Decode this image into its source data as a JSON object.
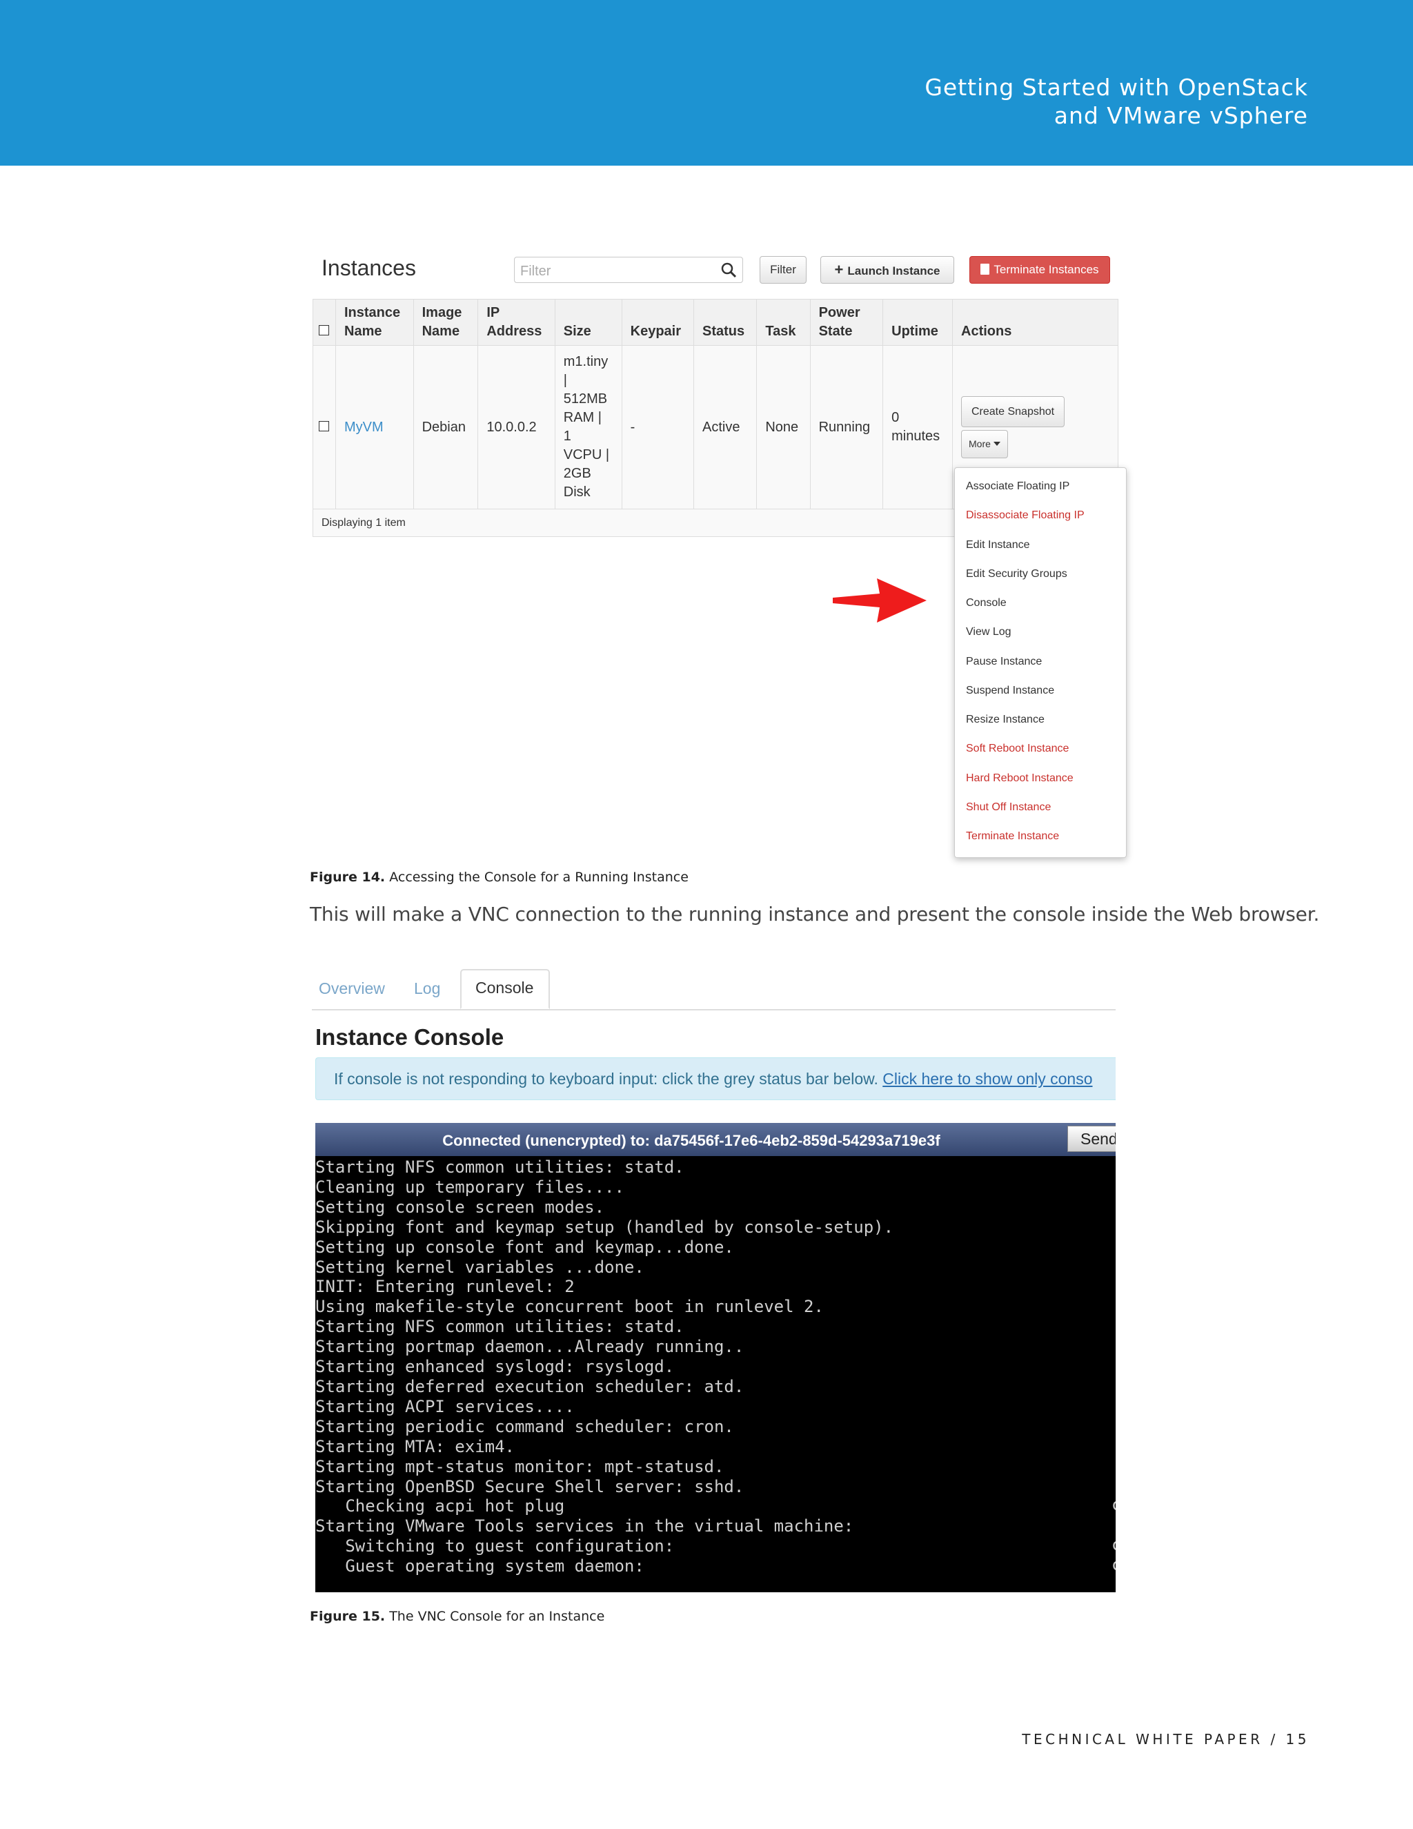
{
  "header": {
    "title_line1": "Getting Started with OpenStack",
    "title_line2": "and VMware vSphere",
    "color": "#1d93d2"
  },
  "instances": {
    "title": "Instances",
    "filter_placeholder": "Filter",
    "filter_button": "Filter",
    "launch_button": "Launch Instance",
    "terminate_button": "Terminate Instances",
    "columns": [
      "Instance Name",
      "Image Name",
      "IP Address",
      "Size",
      "Keypair",
      "Status",
      "Task",
      "Power State",
      "Uptime",
      "Actions"
    ],
    "column_lines": [
      [
        "Instance",
        "Name"
      ],
      [
        "Image",
        "Name"
      ],
      [
        "IP",
        "Address"
      ],
      [
        "Size"
      ],
      [
        "Keypair"
      ],
      [
        "Status"
      ],
      [
        "Task"
      ],
      [
        "Power",
        "State"
      ],
      [
        "Uptime"
      ],
      [
        "Actions"
      ]
    ],
    "row": {
      "instance_name": "MyVM",
      "image_name": "Debian",
      "ip_address": "10.0.0.2",
      "size_lines": [
        "m1.tiny",
        "|",
        "512MB",
        "RAM |",
        "1",
        "VCPU |",
        "2GB",
        "Disk"
      ],
      "keypair": "-",
      "status": "Active",
      "task": "None",
      "power_state": "Running",
      "uptime_lines": [
        "0",
        "minutes"
      ],
      "action_primary": "Create Snapshot",
      "action_more": "More"
    },
    "footer": "Displaying 1 item",
    "more_menu": [
      {
        "label": "Associate Floating IP",
        "danger": false
      },
      {
        "label": "Disassociate Floating IP",
        "danger": true
      },
      {
        "label": "Edit Instance",
        "danger": false
      },
      {
        "label": "Edit Security Groups",
        "danger": false
      },
      {
        "label": "Console",
        "danger": false
      },
      {
        "label": "View Log",
        "danger": false
      },
      {
        "label": "Pause Instance",
        "danger": false
      },
      {
        "label": "Suspend Instance",
        "danger": false
      },
      {
        "label": "Resize Instance",
        "danger": false
      },
      {
        "label": "Soft Reboot Instance",
        "danger": true
      },
      {
        "label": "Hard Reboot Instance",
        "danger": true
      },
      {
        "label": "Shut Off Instance",
        "danger": true
      },
      {
        "label": "Terminate Instance",
        "danger": true
      }
    ]
  },
  "figure14_caption": {
    "label": "Figure 14.",
    "text": "Accessing the Console for a Running Instance"
  },
  "body_text": "This will make a VNC connection to the running instance and present the console inside the Web browser.",
  "console": {
    "tabs": [
      "Overview",
      "Log",
      "Console"
    ],
    "active_tab": "Console",
    "title": "Instance Console",
    "info_text": "If console is not responding to keyboard input: click the grey status bar below.",
    "info_link": "Click here to show only conso",
    "vnc_status": "Connected (unencrypted) to: da75456f-17e6-4eb2-859d-54293a719e3f",
    "vnc_send_button": "Send",
    "terminal_lines": [
      "Starting NFS common utilities: statd.",
      "Cleaning up temporary files....",
      "Setting console screen modes.",
      "Skipping font and keymap setup (handled by console-setup).",
      "Setting up console font and keymap...done.",
      "Setting kernel variables ...done.",
      "INIT: Entering runlevel: 2",
      "Using makefile-style concurrent boot in runlevel 2.",
      "Starting NFS common utilities: statd.",
      "Starting portmap daemon...Already running..",
      "Starting enhanced syslogd: rsyslogd.",
      "Starting deferred execution scheduler: atd.",
      "Starting ACPI services....",
      "Starting periodic command scheduler: cron.",
      "Starting MTA: exim4.",
      "Starting mpt-status monitor: mpt-statusd.",
      "Starting OpenBSD Secure Shell server: sshd.",
      "   Checking acpi hot plug",
      "Starting VMware Tools services in the virtual machine:",
      "   Switching to guest configuration:",
      "   Guest operating system daemon:"
    ],
    "terminal_right_fragment": "c"
  },
  "figure15_caption": {
    "label": "Figure 15.",
    "text": "The VNC Console for an Instance"
  },
  "footer": "TECHNICAL WHITE PAPER / 15"
}
